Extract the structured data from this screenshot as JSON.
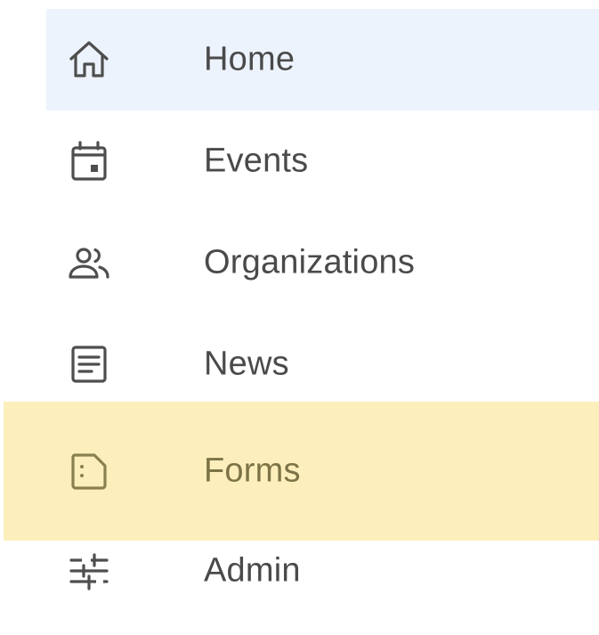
{
  "nav": {
    "items": [
      {
        "label": "Home",
        "icon": "home-icon",
        "state": "active"
      },
      {
        "label": "Events",
        "icon": "calendar-icon"
      },
      {
        "label": "Organizations",
        "icon": "people-icon"
      },
      {
        "label": "News",
        "icon": "article-icon"
      },
      {
        "label": "Forms",
        "icon": "form-icon",
        "state": "hovered"
      },
      {
        "label": "Admin",
        "icon": "sliders-icon"
      }
    ]
  },
  "colors": {
    "active_bg": "#edf3fc",
    "highlight_bg": "#fcefbb",
    "text": "#4a4a4a",
    "highlight_text": "#7c7347"
  }
}
